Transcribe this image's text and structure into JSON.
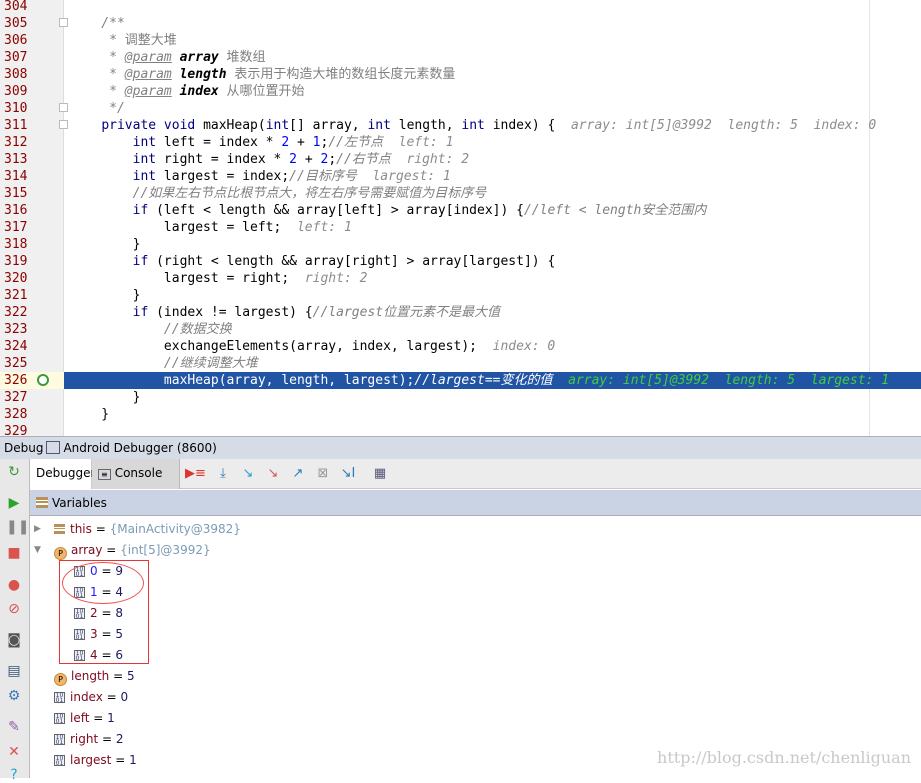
{
  "editor": {
    "lines": [
      {
        "n": "304",
        "seg": []
      },
      {
        "n": "305",
        "seg": [
          [
            "    /**",
            "cm"
          ]
        ]
      },
      {
        "n": "306",
        "seg": [
          [
            "     * ",
            "cm"
          ],
          [
            "调整大堆",
            "cmz"
          ]
        ]
      },
      {
        "n": "307",
        "seg": [
          [
            "     * ",
            "cm"
          ],
          [
            "@param",
            "tag"
          ],
          [
            " ",
            ""
          ],
          [
            "array",
            "pn"
          ],
          [
            " 堆数组",
            "cmz"
          ]
        ]
      },
      {
        "n": "308",
        "seg": [
          [
            "     * ",
            "cm"
          ],
          [
            "@param",
            "tag"
          ],
          [
            " ",
            ""
          ],
          [
            "length",
            "pn"
          ],
          [
            " 表示用于构造大堆的数组长度元素数量",
            "cmz"
          ]
        ]
      },
      {
        "n": "309",
        "seg": [
          [
            "     * ",
            "cm"
          ],
          [
            "@param",
            "tag"
          ],
          [
            " ",
            ""
          ],
          [
            "index",
            "pn"
          ],
          [
            " 从哪位置开始",
            "cmz"
          ]
        ]
      },
      {
        "n": "310",
        "seg": [
          [
            "     */",
            "cm"
          ]
        ]
      },
      {
        "n": "311",
        "seg": [
          [
            "    ",
            ""
          ],
          [
            "private void ",
            "kw"
          ],
          [
            "maxHeap(",
            ""
          ],
          [
            "int",
            "kw"
          ],
          [
            "[] array, ",
            ""
          ],
          [
            "int",
            "kw"
          ],
          [
            " length, ",
            ""
          ],
          [
            "int",
            "kw"
          ],
          [
            " index) {  ",
            ""
          ],
          [
            "array: int[5]@3992  length: 5  index: 0",
            "hint"
          ]
        ]
      },
      {
        "n": "312",
        "seg": [
          [
            "        ",
            ""
          ],
          [
            "int",
            "kw"
          ],
          [
            " left = index * ",
            ""
          ],
          [
            "2",
            "num2"
          ],
          [
            " + ",
            ""
          ],
          [
            "1",
            "num2"
          ],
          [
            ";",
            ""
          ],
          [
            "//左节点",
            "cm"
          ],
          [
            "  left: 1",
            "hint"
          ]
        ]
      },
      {
        "n": "313",
        "seg": [
          [
            "        ",
            ""
          ],
          [
            "int",
            "kw"
          ],
          [
            " right = index * ",
            ""
          ],
          [
            "2",
            "num2"
          ],
          [
            " + ",
            ""
          ],
          [
            "2",
            "num2"
          ],
          [
            ";",
            ""
          ],
          [
            "//右节点",
            "cm"
          ],
          [
            "  right: 2",
            "hint"
          ]
        ]
      },
      {
        "n": "314",
        "seg": [
          [
            "        ",
            ""
          ],
          [
            "int",
            "kw"
          ],
          [
            " largest = index;",
            ""
          ],
          [
            "//目标序号",
            "cm"
          ],
          [
            "  largest: 1",
            "hint"
          ]
        ]
      },
      {
        "n": "315",
        "seg": [
          [
            "        ",
            ""
          ],
          [
            "//如果左右节点比根节点大，将左右序号需要赋值为目标序号",
            "cm"
          ]
        ]
      },
      {
        "n": "316",
        "seg": [
          [
            "        ",
            ""
          ],
          [
            "if",
            "kw"
          ],
          [
            " (left < length && array[left] > array[index]) {",
            ""
          ],
          [
            "//left < length安全范围内",
            "cm"
          ]
        ]
      },
      {
        "n": "317",
        "seg": [
          [
            "            largest = left;  ",
            ""
          ],
          [
            "left: 1",
            "hint"
          ]
        ]
      },
      {
        "n": "318",
        "seg": [
          [
            "        }",
            ""
          ]
        ]
      },
      {
        "n": "319",
        "seg": [
          [
            "        ",
            ""
          ],
          [
            "if",
            "kw"
          ],
          [
            " (right < length && array[right] > array[largest]) {",
            ""
          ]
        ]
      },
      {
        "n": "320",
        "seg": [
          [
            "            largest = right;  ",
            ""
          ],
          [
            "right: 2",
            "hint"
          ]
        ]
      },
      {
        "n": "321",
        "seg": [
          [
            "        }",
            ""
          ]
        ]
      },
      {
        "n": "322",
        "seg": [
          [
            "        ",
            ""
          ],
          [
            "if",
            "kw"
          ],
          [
            " (index != largest) {",
            ""
          ],
          [
            "//largest位置元素不是最大值",
            "cm"
          ]
        ]
      },
      {
        "n": "323",
        "seg": [
          [
            "            ",
            ""
          ],
          [
            "//数据交换",
            "cm"
          ]
        ]
      },
      {
        "n": "324",
        "seg": [
          [
            "            exchangeElements(array, index, largest);  ",
            ""
          ],
          [
            "index: 0",
            "hint"
          ]
        ]
      },
      {
        "n": "325",
        "seg": [
          [
            "            ",
            ""
          ],
          [
            "//继续调整大堆",
            "cm"
          ]
        ]
      },
      {
        "n": "326",
        "seg": [
          [
            "            maxHeap(array, length, largest);",
            ""
          ],
          [
            "//largest==变化的值",
            "cm"
          ],
          [
            "  array: int[5]@3992  length: 5  largest: 1",
            "hint"
          ]
        ],
        "selected": true
      },
      {
        "n": "327",
        "seg": [
          [
            "        }",
            ""
          ]
        ]
      },
      {
        "n": "328",
        "seg": [
          [
            "    }",
            ""
          ]
        ]
      },
      {
        "n": "329",
        "seg": []
      }
    ]
  },
  "debug": {
    "title_prefix": "Debug",
    "session": "Android Debugger (8600)",
    "tabs": {
      "debugger": "Debugger",
      "console": "Console"
    },
    "variables_title": "Variables",
    "vars": {
      "this": {
        "name": "this",
        "value": "{MainActivity@3982}"
      },
      "array": {
        "name": "array",
        "value": "{int[5]@3992}"
      },
      "elements": [
        {
          "i": "0",
          "v": "9"
        },
        {
          "i": "1",
          "v": "4"
        },
        {
          "i": "2",
          "v": "8"
        },
        {
          "i": "3",
          "v": "5"
        },
        {
          "i": "4",
          "v": "6"
        }
      ],
      "locals": [
        {
          "name": "length",
          "value": "5",
          "param": true
        },
        {
          "name": "index",
          "value": "0"
        },
        {
          "name": "left",
          "value": "1"
        },
        {
          "name": "right",
          "value": "2"
        },
        {
          "name": "largest",
          "value": "1"
        }
      ]
    }
  },
  "watermark": "http://blog.csdn.net/chenliguan",
  "colors": {
    "selection": "#2154a5",
    "keyword": "#000080",
    "hint_selected": "#3ecf3e",
    "annotation": "#e53535"
  }
}
